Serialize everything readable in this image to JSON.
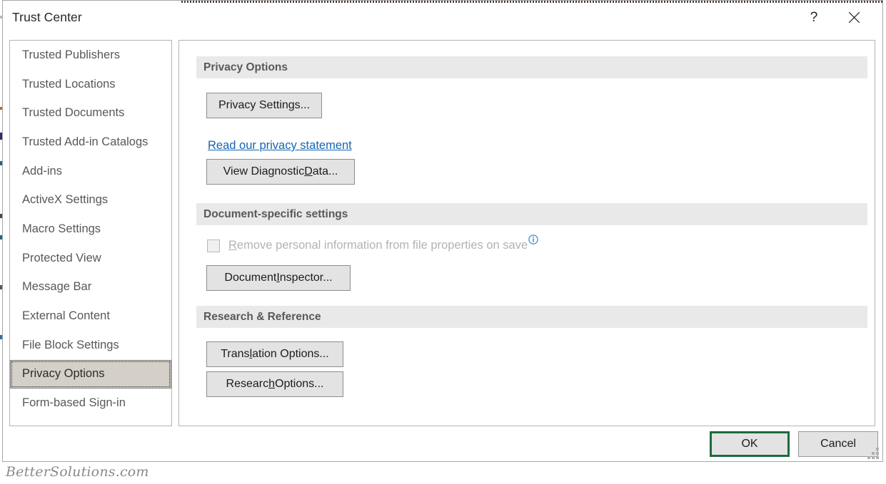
{
  "window": {
    "title": "Trust Center",
    "help_icon": "question-mark-icon",
    "close_icon": "close-x-icon",
    "help_label": "?",
    "close_label": "✕"
  },
  "sidebar": {
    "items": [
      {
        "label": "Trusted Publishers",
        "selected": false
      },
      {
        "label": "Trusted Locations",
        "selected": false
      },
      {
        "label": "Trusted Documents",
        "selected": false
      },
      {
        "label": "Trusted Add-in Catalogs",
        "selected": false
      },
      {
        "label": "Add-ins",
        "selected": false
      },
      {
        "label": "ActiveX Settings",
        "selected": false
      },
      {
        "label": "Macro Settings",
        "selected": false
      },
      {
        "label": "Protected View",
        "selected": false
      },
      {
        "label": "Message Bar",
        "selected": false
      },
      {
        "label": "External Content",
        "selected": false
      },
      {
        "label": "File Block Settings",
        "selected": false
      },
      {
        "label": "Privacy Options",
        "selected": true
      },
      {
        "label": "Form-based Sign-in",
        "selected": false
      }
    ]
  },
  "content": {
    "sections": [
      {
        "title": "Privacy Options"
      },
      {
        "title": "Document-specific settings"
      },
      {
        "title": "Research & Reference"
      }
    ],
    "privacy_settings_button": "Privacy Settings...",
    "privacy_statement_link": "Read our privacy statement",
    "view_diagnostic_button_pre": "View Diagnostic ",
    "view_diagnostic_button_accel": "D",
    "view_diagnostic_button_post": "ata...",
    "remove_personal_info_pre": "",
    "remove_personal_info_accel": "R",
    "remove_personal_info_post": "emove personal information from file properties on save",
    "remove_personal_info_checked": false,
    "remove_personal_info_enabled": false,
    "info_icon": "info-circle-icon",
    "document_inspector_pre": "Document ",
    "document_inspector_accel": "I",
    "document_inspector_post": "nspector...",
    "translation_options_pre": "Trans",
    "translation_options_accel": "l",
    "translation_options_post": "ation Options...",
    "research_options_pre": "Researc",
    "research_options_accel": "h",
    "research_options_post": " Options..."
  },
  "footer": {
    "ok_label": "OK",
    "cancel_label": "Cancel"
  },
  "watermark": {
    "text": "BetterSolutions.com"
  },
  "colors": {
    "accent_link": "#1464b4",
    "default_button_border": "#1c6b3c",
    "section_header_bg": "#e9e9e9",
    "selected_item_bg": "#d4d0c8",
    "disabled_text": "#b3b3b3",
    "info_icon": "#4a86c8"
  }
}
